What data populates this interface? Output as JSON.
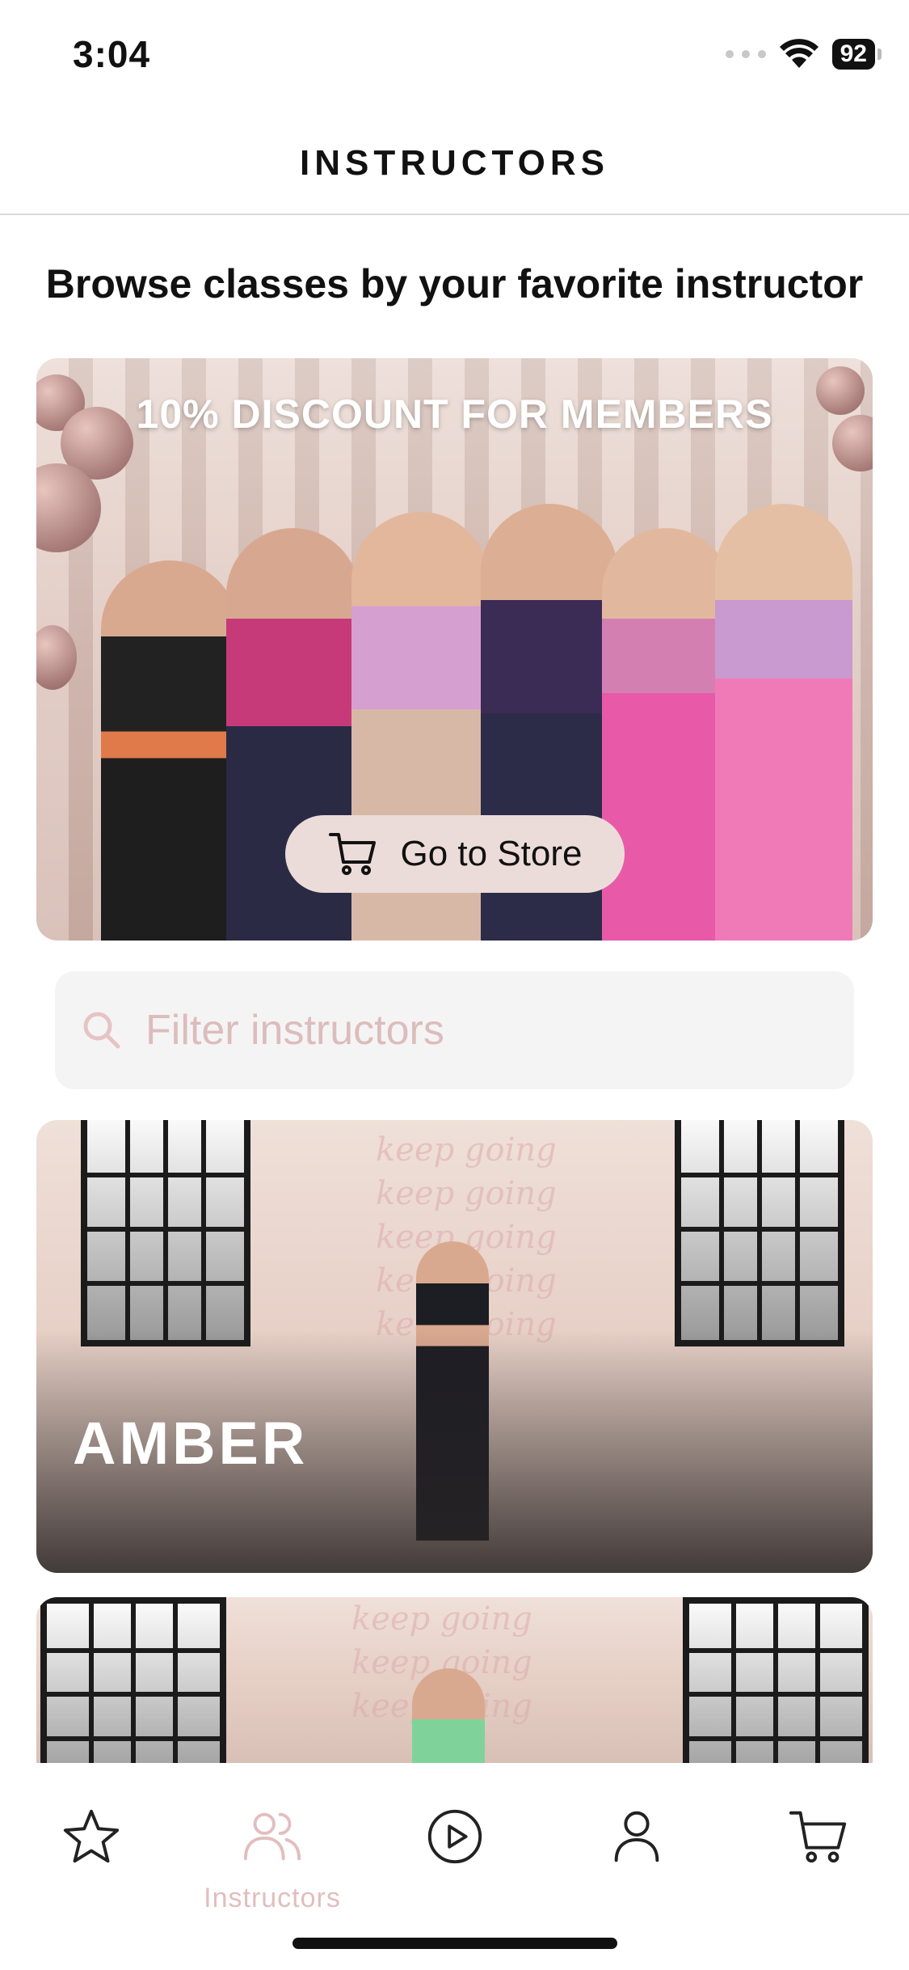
{
  "status_bar": {
    "time": "3:04",
    "battery": "92"
  },
  "header": {
    "title": "INSTRUCTORS"
  },
  "subtitle": "Browse classes by your favorite instructor",
  "promo": {
    "title": "10% DISCOUNT FOR MEMBERS",
    "button_label": "Go to Store",
    "button_icon": "cart-icon"
  },
  "search": {
    "placeholder": "Filter instructors",
    "value": ""
  },
  "instructors": [
    {
      "name": "AMBER"
    },
    {
      "name": ""
    }
  ],
  "tab_bar": {
    "items": [
      {
        "icon": "star-icon",
        "label": "",
        "active": false
      },
      {
        "icon": "instructors-icon",
        "label": "Instructors",
        "active": true
      },
      {
        "icon": "play-icon",
        "label": "",
        "active": false
      },
      {
        "icon": "profile-icon",
        "label": "",
        "active": false
      },
      {
        "icon": "cart-icon",
        "label": "",
        "active": false
      }
    ]
  },
  "colors": {
    "accent": "#e2bebe",
    "button_bg": "#ecdcd9",
    "search_bg": "#f5f4f4",
    "placeholder": "#dcbcbc",
    "text": "#111111"
  }
}
